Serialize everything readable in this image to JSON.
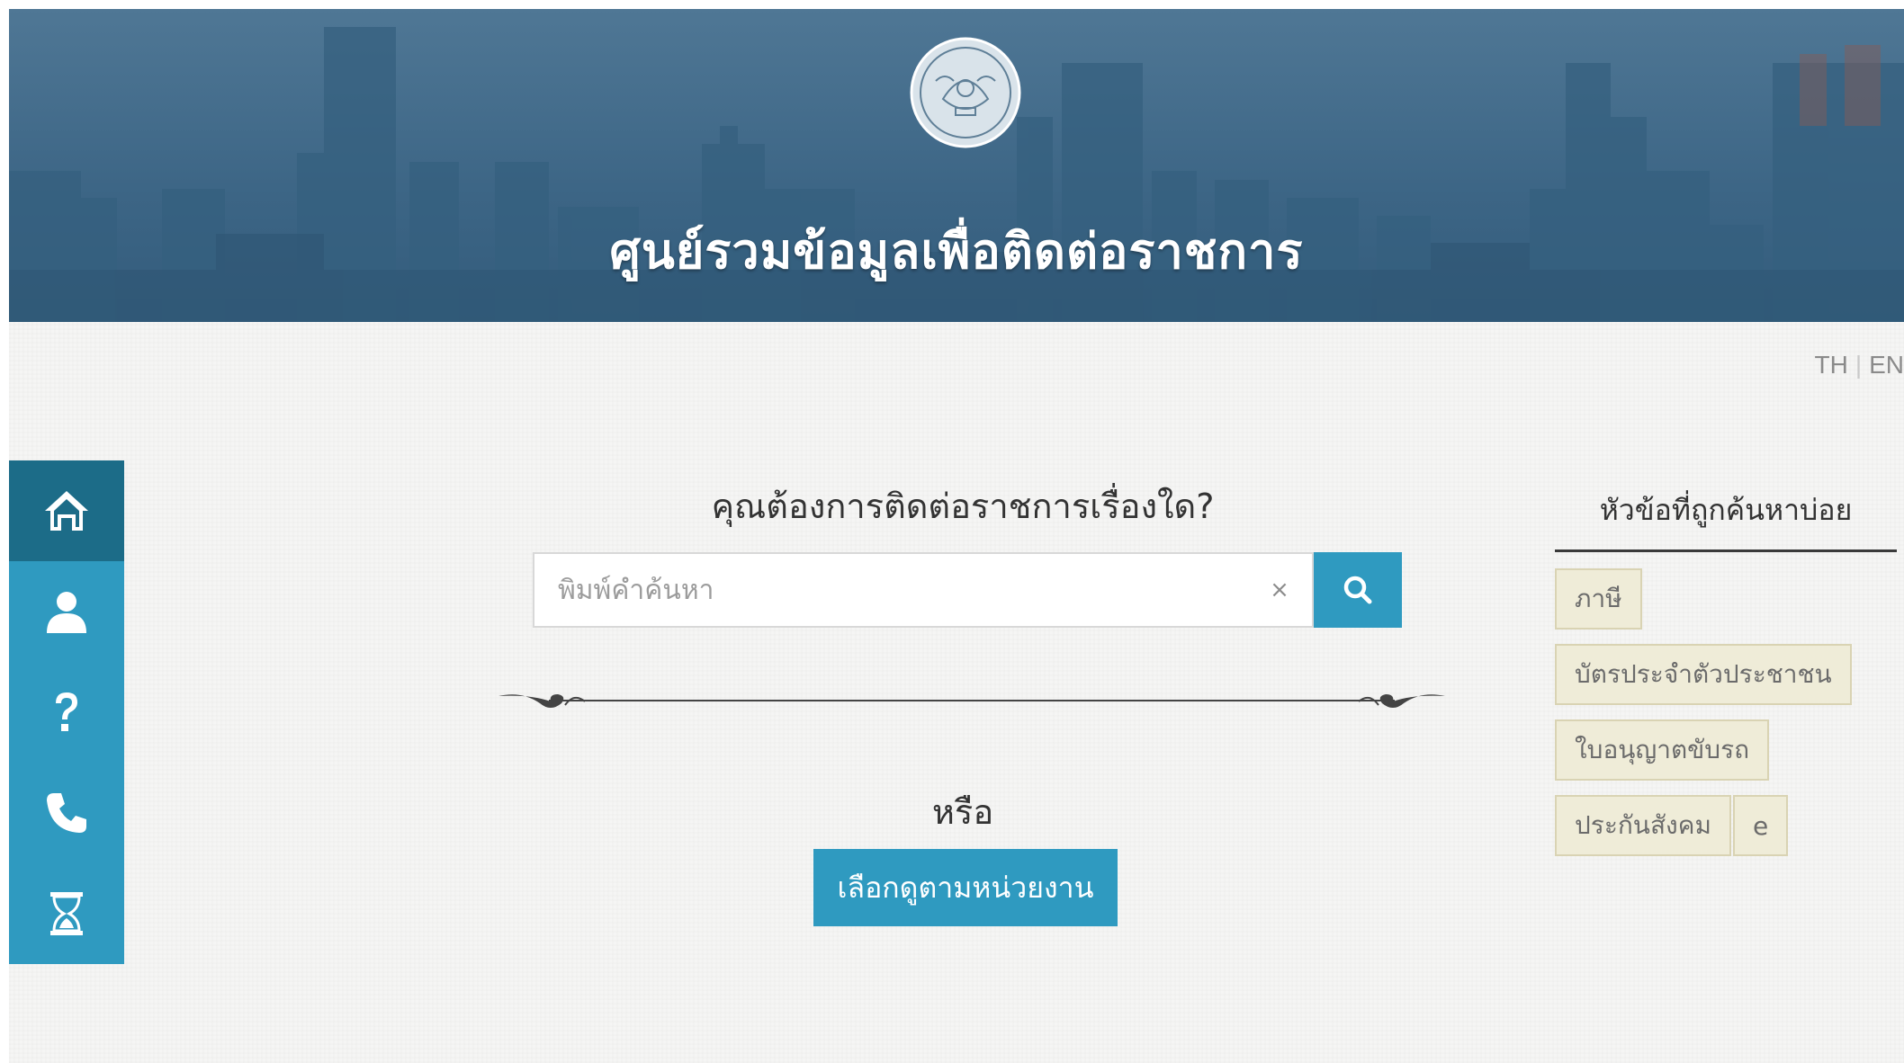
{
  "header": {
    "title": "ศูนย์รวมข้อมูลเพื่อติดต่อราชการ"
  },
  "lang": {
    "th": "TH",
    "separator": "|",
    "en": "EN"
  },
  "sidebar": {
    "items": [
      {
        "icon": "home-icon",
        "active": true
      },
      {
        "icon": "user-icon",
        "active": false
      },
      {
        "icon": "question-icon",
        "active": false
      },
      {
        "icon": "phone-icon",
        "active": false
      },
      {
        "icon": "hourglass-icon",
        "active": false
      }
    ]
  },
  "search": {
    "question": "คุณต้องการติดต่อราชการเรื่องใด?",
    "placeholder": "พิมพ์คำค้นหา",
    "value": "",
    "clear_label": "×"
  },
  "or_label": "หรือ",
  "browse_button": "เลือกดูตามหน่วยงาน",
  "popular": {
    "title": "หัวข้อที่ถูกค้นหาบ่อย",
    "tags": [
      "ภาษี",
      "บัตรประจำตัวประชาชน",
      "ใบอนุญาตขับรถ",
      "ประกันสังคม",
      "e"
    ]
  },
  "colors": {
    "primary": "#2f9ac0",
    "primary_dark": "#1c6c88",
    "banner": "#3c6585",
    "tag_bg": "#efecd8"
  }
}
